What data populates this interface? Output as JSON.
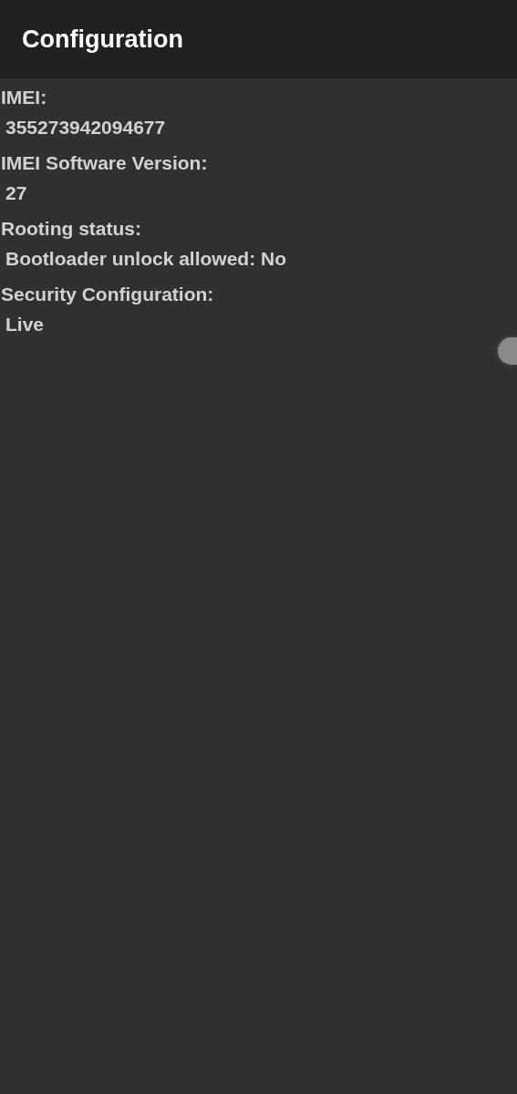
{
  "app_bar": {
    "title": "Configuration"
  },
  "fields": [
    {
      "label": "IMEI:",
      "value": "355273942094677"
    },
    {
      "label": "IMEI Software Version:",
      "value": "27"
    },
    {
      "label": "Rooting status:",
      "value": "Bootloader unlock allowed: No"
    },
    {
      "label": "Security Configuration:",
      "value": "Live"
    }
  ]
}
